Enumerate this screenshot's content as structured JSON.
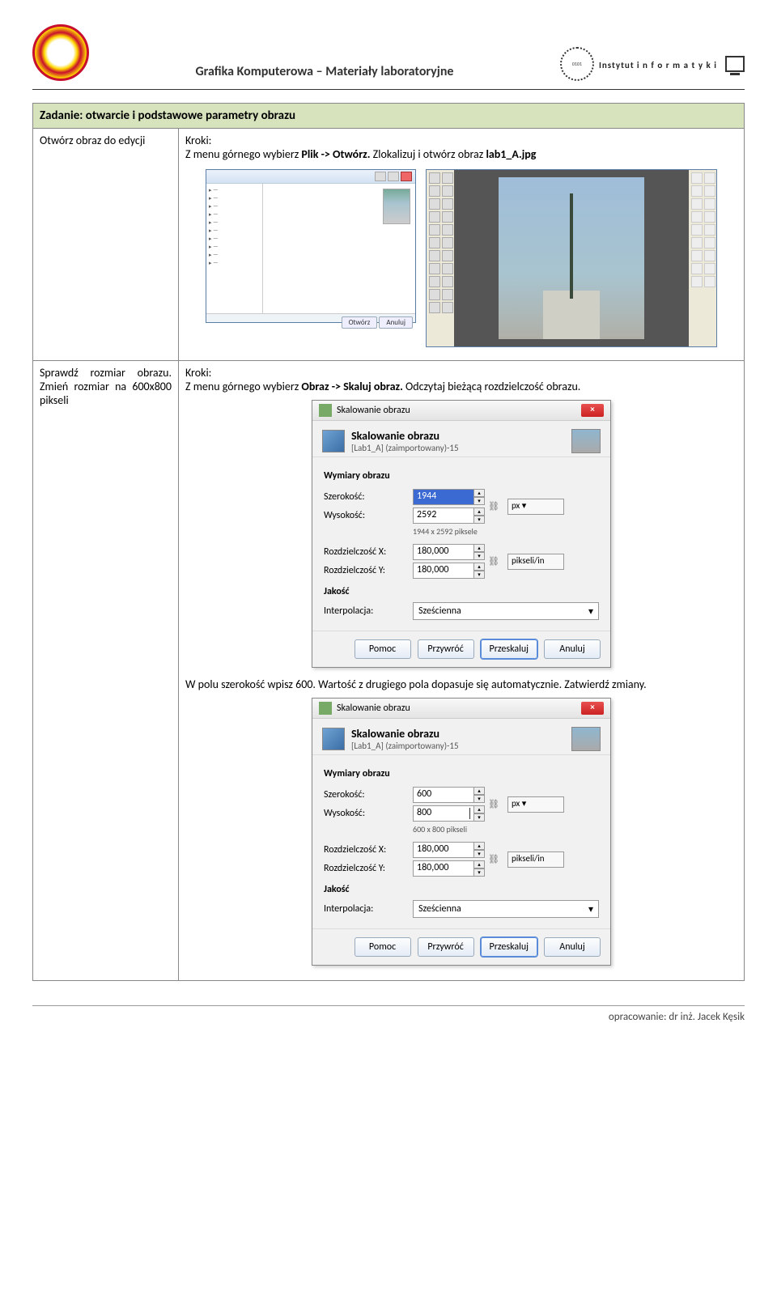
{
  "header": {
    "title": "Grafika Komputerowa – Materiały laboratoryjne",
    "brand": "Instytut",
    "brand_sub": "i n f o r m a t y k i"
  },
  "task_title": "Zadanie: otwarcie i podstawowe parametry obrazu",
  "step1": {
    "left": "Otwórz obraz do edycji",
    "kroki": "Kroki:",
    "text_a": "Z menu górnego wybierz ",
    "bold_a": "Plik -> Otwórz.",
    "text_b": " Zlokalizuj i otwórz obraz ",
    "bold_b": "lab1_A.jpg"
  },
  "step2": {
    "left": "Sprawdź rozmiar obrazu. Zmień rozmiar na 600x800 pikseli",
    "kroki": "Kroki:",
    "text_a": "Z menu górnego wybierz ",
    "bold_a": "Obraz -> Skaluj obraz.",
    "text_b": " Odczytaj bieżącą rozdzielczość obrazu.",
    "text_c": "W polu szerokość wpisz 600. Wartość z drugiego pola dopasuje się automatycznie. Zatwierdź zmiany."
  },
  "filedialog": {
    "btn_open": "Otwórz",
    "btn_cancel": "Anuluj"
  },
  "dialog": {
    "title": "Skalowanie obrazu",
    "heading": "Skalowanie obrazu",
    "subheading": "[Lab1_A] (zaimportowany)-15",
    "section_dims": "Wymiary obrazu",
    "width_label": "Szerokość:",
    "height_label": "Wysokość:",
    "resx_label": "Rozdzielczość X:",
    "resy_label": "Rozdzielczość Y:",
    "unit_px": "px ▾",
    "unit_ppi": "pikseli/in",
    "section_quality": "Jakość",
    "interp_label": "Interpolacja:",
    "interp_value": "Sześcienna",
    "btn_help": "Pomoc",
    "btn_reset": "Przywróć",
    "btn_scale": "Przeskaluj",
    "btn_cancel": "Anuluj"
  },
  "d1": {
    "width": "1944",
    "height": "2592",
    "dims_text": "1944 x 2592 piksele",
    "resx": "180,000",
    "resy": "180,000"
  },
  "d2": {
    "width": "600",
    "height": "800",
    "dims_text": "600 x 800 pikseli",
    "resx": "180,000",
    "resy": "180,000"
  },
  "footer": "opracowanie: dr inż. Jacek Kęsik"
}
